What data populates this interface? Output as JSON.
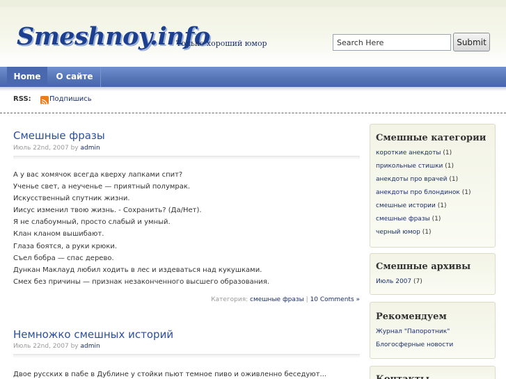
{
  "header": {
    "logo": "Smeshnoy.info",
    "tagline": "Только хороший юмор",
    "search_placeholder": "Search Here",
    "submit_label": "Submit"
  },
  "nav": {
    "items": [
      {
        "label": "Home"
      },
      {
        "label": "О сайте"
      }
    ]
  },
  "rss": {
    "label": "RSS:",
    "link": "Подпишись"
  },
  "posts": [
    {
      "title": "Смешные фразы",
      "date": "Июль 22nd, 2007 by ",
      "author": "admin",
      "lines": [
        "А у вас хомячок всегда кверху лапками спит?",
        "Ученье свет, а неученье — приятный полумрак.",
        "Искусственный спутник жизни.",
        "Иисус изменил твою жизнь. - Сохранить? (Да/Нет).",
        "Я не слабоумный, просто слабый и умный.",
        "Клан кланом вышибают.",
        "Глаза боятся, а руки крюки.",
        "Съел бобра — спас дерево.",
        "Дункан Маклауд любил ходить в лес и издеваться над кукушками.",
        "Смех без причины — признак незаконченного высшего образования."
      ],
      "category_label": "Категория: ",
      "category": "смешные фразы",
      "separator": " | ",
      "comments": "10 Comments »"
    },
    {
      "title": "Немножко смешных историй",
      "date": "Июль 22nd, 2007 by ",
      "author": "admin",
      "lines": [
        "Двое русских в пабе в Дублине у стойки пьют темное пиво и оживленно беседуют..."
      ]
    }
  ],
  "sidebar": {
    "categories": {
      "title": "Смешные категории",
      "items": [
        {
          "label": "короткие анекдоты",
          "count": " (1)"
        },
        {
          "label": "прикольные стишки",
          "count": " (1)"
        },
        {
          "label": "анекдоты про врачей",
          "count": " (1)"
        },
        {
          "label": "анекдоты про блондинок",
          "count": " (1)"
        },
        {
          "label": "смешные истории",
          "count": " (1)"
        },
        {
          "label": "смешные фразы",
          "count": " (1)"
        },
        {
          "label": "черный юмор",
          "count": " (1)"
        }
      ]
    },
    "archives": {
      "title": "Смешные архивы",
      "items": [
        {
          "label": "Июль 2007",
          "count": " (7)"
        }
      ]
    },
    "recommend": {
      "title": "Рекомендуем",
      "items": [
        {
          "label": "Журнал \"Папоротник\""
        },
        {
          "label": "Блогосферные новости"
        }
      ]
    },
    "fourth": {
      "title": "Контакты"
    }
  }
}
